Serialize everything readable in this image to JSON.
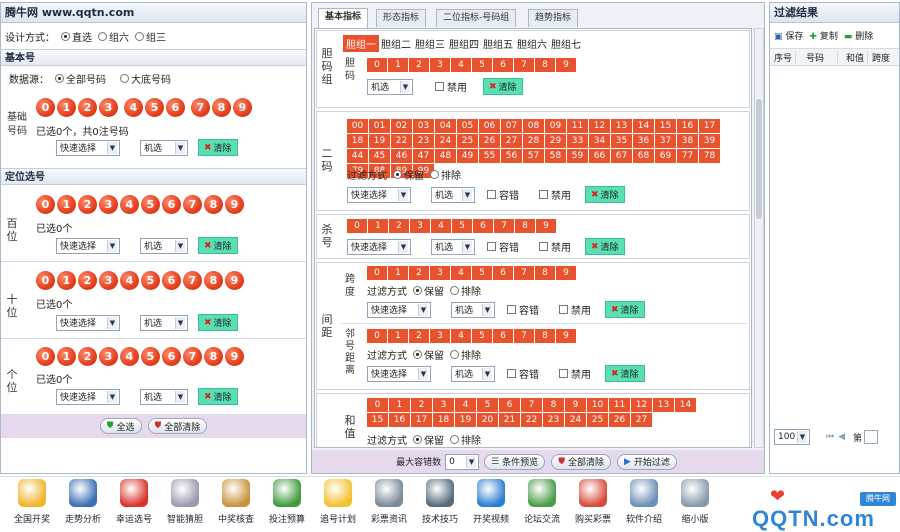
{
  "left": {
    "title": "腾牛网 www.qqtn.com",
    "mode_label": "设计方式：",
    "modes": [
      "直选",
      "组六",
      "组三"
    ],
    "basic_header": "基本号",
    "source_label": "数据源：",
    "sources": [
      "全部号码",
      "大底号码"
    ],
    "basic_label": "基础号码",
    "basic_balls": [
      "0",
      "1",
      "2",
      "3",
      "4",
      "5",
      "6",
      "7",
      "8",
      "9"
    ],
    "basic_count": "已选0个，共0注号码",
    "quick": "快速选择",
    "random": "机选",
    "clear": "清除",
    "position_header": "定位选号",
    "positions": [
      {
        "label": "百位",
        "count": "已选0个",
        "balls": [
          "0",
          "1",
          "2",
          "3",
          "4",
          "5",
          "6",
          "7",
          "8",
          "9"
        ]
      },
      {
        "label": "十位",
        "count": "已选0个",
        "balls": [
          "0",
          "1",
          "2",
          "3",
          "4",
          "5",
          "6",
          "7",
          "8",
          "9"
        ]
      },
      {
        "label": "个位",
        "count": "已选0个",
        "balls": [
          "0",
          "1",
          "2",
          "3",
          "4",
          "5",
          "6",
          "7",
          "8",
          "9"
        ]
      }
    ],
    "btn_all": "全选",
    "btn_clear_all": "全部清除"
  },
  "mid": {
    "tabs": [
      "基本指标",
      "形态指标",
      "二位指标-号码组",
      "趋势指标"
    ],
    "group1": {
      "label": "胆码组",
      "sub_tabs": [
        "胆组一",
        "胆组二",
        "胆组三",
        "胆组四",
        "胆组五",
        "胆组六",
        "胆组七"
      ],
      "row_label": "胆码",
      "nums": [
        "0",
        "1",
        "2",
        "3",
        "4",
        "5",
        "6",
        "7",
        "8",
        "9"
      ],
      "disable": "禁用"
    },
    "group2": {
      "label": "二码",
      "nums": [
        "00",
        "01",
        "02",
        "03",
        "04",
        "05",
        "06",
        "07",
        "08",
        "09",
        "11",
        "12",
        "13",
        "14",
        "15",
        "16",
        "17",
        "18",
        "19",
        "22",
        "23",
        "24",
        "25",
        "26",
        "27",
        "28",
        "29",
        "33",
        "34",
        "35",
        "36",
        "37",
        "38",
        "39",
        "44",
        "45",
        "46",
        "47",
        "48",
        "49",
        "55",
        "56",
        "57",
        "58",
        "59",
        "66",
        "67",
        "68",
        "69",
        "77",
        "78",
        "79",
        "88",
        "89",
        "99"
      ],
      "filter": "过滤方式",
      "keep": "保留",
      "exclude": "排除",
      "tolerance": "容错",
      "disable": "禁用"
    },
    "group3": {
      "label": "杀号",
      "nums": [
        "0",
        "1",
        "2",
        "3",
        "4",
        "5",
        "6",
        "7",
        "8",
        "9"
      ]
    },
    "group4": {
      "label": "间距",
      "span_label": "跨度",
      "adj_label": "邻号距离",
      "nums": [
        "0",
        "1",
        "2",
        "3",
        "4",
        "5",
        "6",
        "7",
        "8",
        "9"
      ]
    },
    "group5": {
      "label": "和值",
      "nums": [
        "0",
        "1",
        "2",
        "3",
        "4",
        "5",
        "6",
        "7",
        "8",
        "9",
        "10",
        "11",
        "12",
        "13",
        "14",
        "15",
        "16",
        "17",
        "18",
        "19",
        "20",
        "21",
        "22",
        "23",
        "24",
        "25",
        "26",
        "27"
      ]
    },
    "bottom": {
      "max_tol": "最大容错数",
      "max_val": "0",
      "opt": "条件预览",
      "clear_all": "全部清除",
      "start": "开始过滤"
    }
  },
  "right": {
    "title": "过滤结果",
    "tools": [
      "保存",
      "复制",
      "删除"
    ],
    "cols": [
      "序号",
      "号码",
      "和值",
      "跨度"
    ],
    "page_size": "100",
    "page_label": "第"
  },
  "dock": [
    "全国开奖",
    "走势分析",
    "幸运选号",
    "智能猜胆",
    "中奖核查",
    "投注预算",
    "追号计划",
    "彩票资讯",
    "技术技巧",
    "开奖视频",
    "论坛交流",
    "购买彩票",
    "软件介绍",
    "缩小版"
  ],
  "watermark": "QQTN.com",
  "watermark_small": "腾牛网"
}
